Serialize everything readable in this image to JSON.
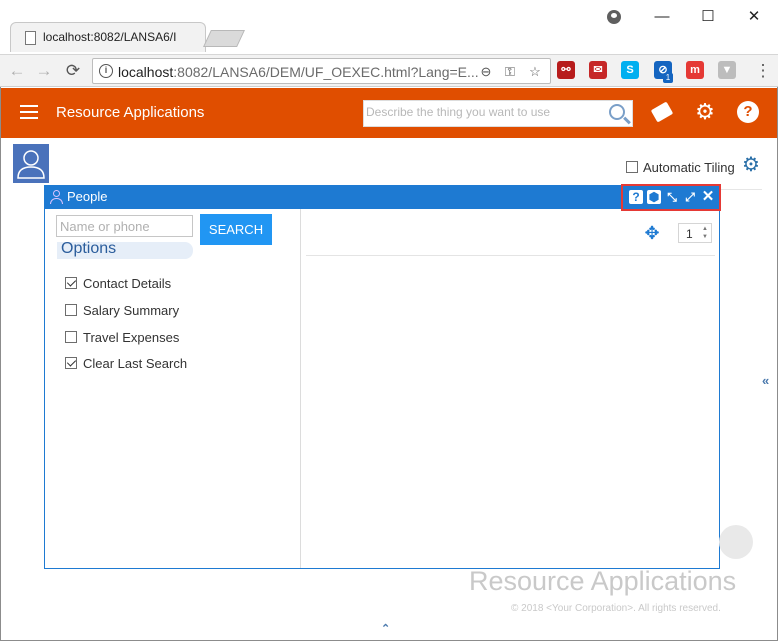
{
  "browser": {
    "tab_title": "localhost:8082/LANSA6/I",
    "url_host": "localhost",
    "url_rest": ":8082/LANSA6/DEM/UF_OEXEC.html?Lang=E...",
    "nav_back": "←",
    "nav_forward": "→",
    "nav_reload": "⟳",
    "info_icon": "i",
    "win_minimize": "—",
    "win_maximize": "☐",
    "win_close": "✕",
    "zoom_icon": "⊖",
    "key_icon": "⚿",
    "star_icon": "☆",
    "extensions": [
      {
        "name": "pdf-extension-icon",
        "glyph": "⚯",
        "color": "#b71c1c"
      },
      {
        "name": "mail-extension-icon",
        "glyph": "✉",
        "color": "#c62828"
      },
      {
        "name": "skype-extension-icon",
        "glyph": "S",
        "color": "#00aff0"
      },
      {
        "name": "blocker-extension-icon",
        "glyph": "⊘",
        "color": "#1565c0",
        "badge": "1"
      },
      {
        "name": "m-extension-icon",
        "glyph": "m",
        "color": "#e53935"
      },
      {
        "name": "filter-extension-icon",
        "glyph": "▼",
        "color": "#bdbdbd"
      }
    ],
    "menu_icon": "⋮"
  },
  "appbar": {
    "title": "Resource Applications",
    "search_placeholder": "Describe the thing you want to use",
    "help_label": "?",
    "gear_glyph": "⚙"
  },
  "page": {
    "auto_tiling_label": "Automatic Tiling",
    "auto_tiling_checked": false,
    "gear_glyph": "⚙"
  },
  "people_window": {
    "title": "People",
    "tools": {
      "help": "?",
      "pin": "⬢",
      "collapse": "⤡",
      "expand": "⤢",
      "close": "✕"
    },
    "name_placeholder": "Name or phone",
    "search_label": "SEARCH",
    "options_heading": "Options",
    "options": [
      {
        "label": "Contact Details",
        "checked": true
      },
      {
        "label": "Salary Summary",
        "checked": false
      },
      {
        "label": "Travel Expenses",
        "checked": false
      },
      {
        "label": "Clear Last Search",
        "checked": true
      }
    ],
    "move_glyph": "✥",
    "page_value": "1",
    "spin_up": "▲",
    "spin_down": "▼"
  },
  "footer": {
    "title": "Resource Applications",
    "copyright": "© 2018 <Your Corporation>. All rights reserved.",
    "side_collapse": "«",
    "up_collapse": "⌃"
  },
  "colors": {
    "appbar": "#e04e00",
    "window_bar": "#1e7ad2",
    "search_button": "#2196f3",
    "highlight_box": "#e53935"
  }
}
